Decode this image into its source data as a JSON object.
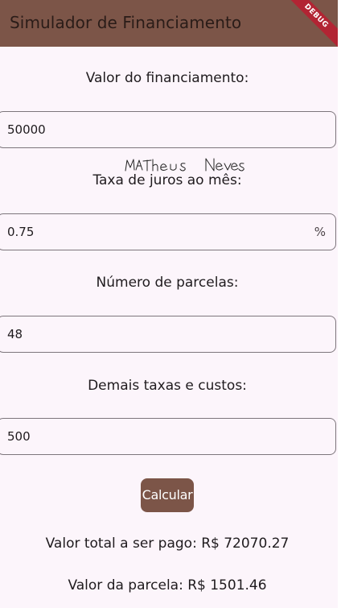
{
  "appbar": {
    "title": "Simulador de Financiamento",
    "debug_badge": "DEBUG"
  },
  "signature_text": "MATheus Neves",
  "form": {
    "loan_value": {
      "label": "Valor do financiamento:",
      "value": "50000"
    },
    "interest_rate": {
      "label": "Taxa de juros ao mês:",
      "value": "0.75",
      "suffix": "%"
    },
    "installments": {
      "label": "Número de parcelas:",
      "value": "48"
    },
    "other_fees": {
      "label": "Demais taxas e custos:",
      "value": "500"
    }
  },
  "calculate_button": {
    "label": "Calcular"
  },
  "results": {
    "total": "Valor total a ser pago: R$ 72070.27",
    "installment": "Valor da parcela: R$ 1501.46"
  },
  "colors": {
    "primary": "#7c5548",
    "background": "#fcf5fb",
    "debug_ribbon": "#b22433",
    "outline": "#7d767c"
  }
}
